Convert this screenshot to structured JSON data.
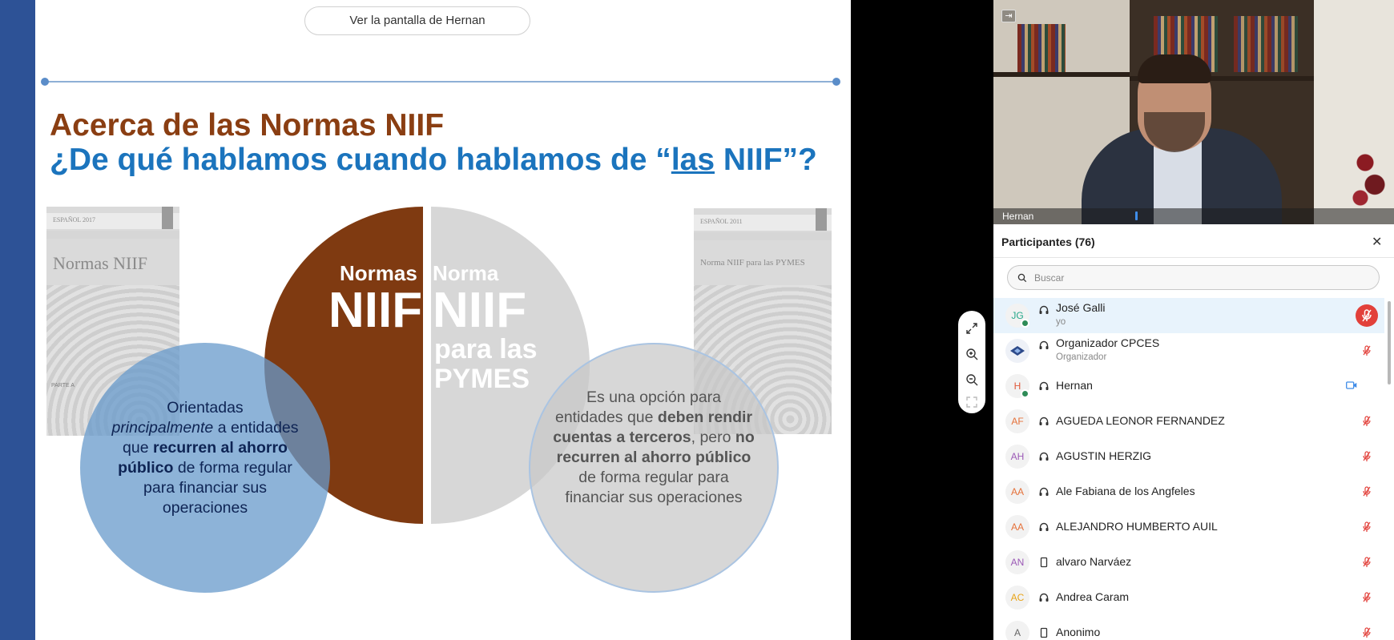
{
  "banner": {
    "label": "Ver la pantalla de Hernan"
  },
  "slide": {
    "title_line1": "Acerca de las Normas NIIF",
    "title_line2_before": "¿De qué hablamos cuando hablamos de “",
    "title_line2_underlined": "las",
    "title_line2_after": " NIIF”?",
    "book_left_header": "ESPAÑOL 2017",
    "book_left_title": "Normas NIIF",
    "book_left_footer": "PARTE A",
    "book_right_header": "ESPAÑOL 2011",
    "book_right_title": "Norma NIIF para las PYMES",
    "left_half_small": "Normas",
    "left_half_big": "NIIF",
    "right_half_small": "Norma",
    "right_half_big": "NIIF",
    "right_half_rest": "para las PYMES",
    "left_circle": {
      "t1": "Orientadas",
      "t2": "principalmente",
      "t3": " a entidades que ",
      "t4": "recurren al ahorro público",
      "t5": " de forma regular para financiar sus operaciones"
    },
    "right_circle": {
      "t1": "Es una opción para entidades que ",
      "t2": "deben rendir cuentas a terceros",
      "t3": ", pero ",
      "t4": "no recurren al ahorro público",
      "t5": " de forma regular para financiar sus operaciones"
    }
  },
  "video": {
    "name": "Hernan"
  },
  "participants": {
    "title": "Participantes (76)",
    "search_placeholder": "Buscar",
    "items": [
      {
        "initials": "JG",
        "name": "José Galli",
        "sub": "yo",
        "device": "headset-icon",
        "initials_color": "#25a88a",
        "status": "muted-active",
        "presence": true
      },
      {
        "initials": "",
        "name": "Organizador CPCES",
        "sub": "Organizador",
        "device": "headset-icon",
        "initials_color": "#2d4a8a",
        "status": "muted",
        "presence": false
      },
      {
        "initials": "H",
        "name": "Hernan",
        "sub": "",
        "device": "headset-icon",
        "initials_color": "#e0593b",
        "status": "video",
        "presence": true
      },
      {
        "initials": "AF",
        "name": "AGUEDA LEONOR FERNANDEZ",
        "sub": "",
        "device": "headset-icon",
        "initials_color": "#e5713a",
        "status": "muted",
        "presence": false
      },
      {
        "initials": "AH",
        "name": "AGUSTIN HERZIG",
        "sub": "",
        "device": "headset-icon",
        "initials_color": "#9b59b6",
        "status": "muted",
        "presence": false
      },
      {
        "initials": "AA",
        "name": "Ale Fabiana de los Angfeles",
        "sub": "",
        "device": "headset-icon",
        "initials_color": "#e5713a",
        "status": "muted",
        "presence": false
      },
      {
        "initials": "AA",
        "name": "ALEJANDRO HUMBERTO AUIL",
        "sub": "",
        "device": "headset-icon",
        "initials_color": "#e5713a",
        "status": "muted",
        "presence": false
      },
      {
        "initials": "AN",
        "name": "alvaro Narváez",
        "sub": "",
        "device": "phone-icon",
        "initials_color": "#9b59b6",
        "status": "muted",
        "presence": false
      },
      {
        "initials": "AC",
        "name": "Andrea Caram",
        "sub": "",
        "device": "headset-icon",
        "initials_color": "#e8a317",
        "status": "muted",
        "presence": false
      },
      {
        "initials": "A",
        "name": "Anonimo",
        "sub": "",
        "device": "phone-icon",
        "initials_color": "#666666",
        "status": "muted",
        "presence": false
      }
    ]
  },
  "colors": {
    "accent_blue": "#1b74bd",
    "title_brown": "#8a3e12",
    "mute_red": "#e2403a",
    "video_blue": "#3f8ce8"
  }
}
